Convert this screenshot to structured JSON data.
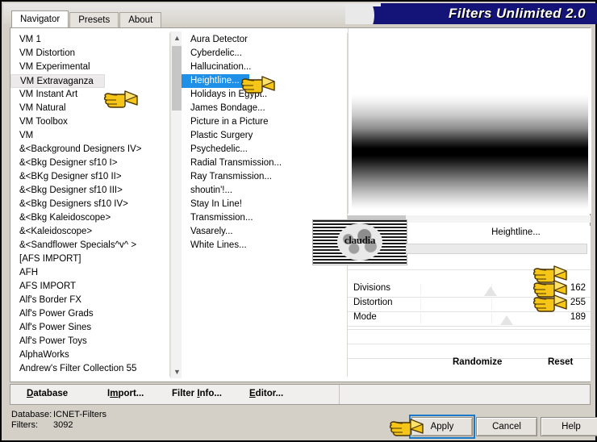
{
  "window": {
    "title": "Filters Unlimited 2.0",
    "accent_navy": "#141478",
    "select_blue": "#1e90e8"
  },
  "tabs": [
    {
      "label": "Navigator",
      "active": true
    },
    {
      "label": "Presets",
      "active": false
    },
    {
      "label": "About",
      "active": false
    }
  ],
  "category_list": {
    "selected": "VM Extravaganza",
    "items": [
      "VM 1",
      "VM Distortion",
      "VM Experimental",
      "VM Extravaganza",
      "VM Instant Art",
      "VM Natural",
      "VM Toolbox",
      "VM",
      "&<Background Designers IV>",
      "&<Bkg Designer sf10 I>",
      "&<BKg Designer sf10 II>",
      "&<Bkg Designer sf10 III>",
      "&<Bkg Designers sf10 IV>",
      "&<Bkg Kaleidoscope>",
      "&<Kaleidoscope>",
      "&<Sandflower Specials^v^ >",
      "[AFS IMPORT]",
      "AFH",
      "AFS IMPORT",
      "Alf's Border FX",
      "Alf's Power Grads",
      "Alf's Power Sines",
      "Alf's Power Toys",
      "AlphaWorks",
      "Andrew's Filter Collection 55"
    ]
  },
  "filter_list": {
    "selected": "Heightline...",
    "items": [
      "Aura Detector",
      "Cyberdelic...",
      "Hallucination...",
      "Heightline...",
      "Holidays in Egypt..",
      "James Bondage...",
      "Picture in a Picture",
      "Plastic Surgery",
      "Psychedelic...",
      "Radial Transmission...",
      "Ray Transmission...",
      "shoutin'!...",
      "Stay In Line!",
      "Transmission...",
      "Vasarely...",
      "White Lines..."
    ]
  },
  "parameters": {
    "filter_title": "Heightline...",
    "thumbnail_word": "claudia",
    "sliders": [
      {
        "name": "Divisions",
        "value": "162",
        "pos_pct": 63
      },
      {
        "name": "Distortion",
        "value": "255",
        "pos_pct": 100
      },
      {
        "name": "Mode",
        "value": "189",
        "pos_pct": 74
      }
    ]
  },
  "actions": {
    "randomize": "Randomize",
    "reset": "Reset"
  },
  "toolbar": {
    "database": "Database",
    "import": "Import...",
    "filter_info": "Filter Info...",
    "editor": "Editor..."
  },
  "status": {
    "database_key": "Database:",
    "database_value": "ICNET-Filters",
    "filters_key": "Filters:",
    "filters_value": "3092"
  },
  "dialog_buttons": {
    "apply": "Apply",
    "cancel": "Cancel",
    "help": "Help"
  }
}
